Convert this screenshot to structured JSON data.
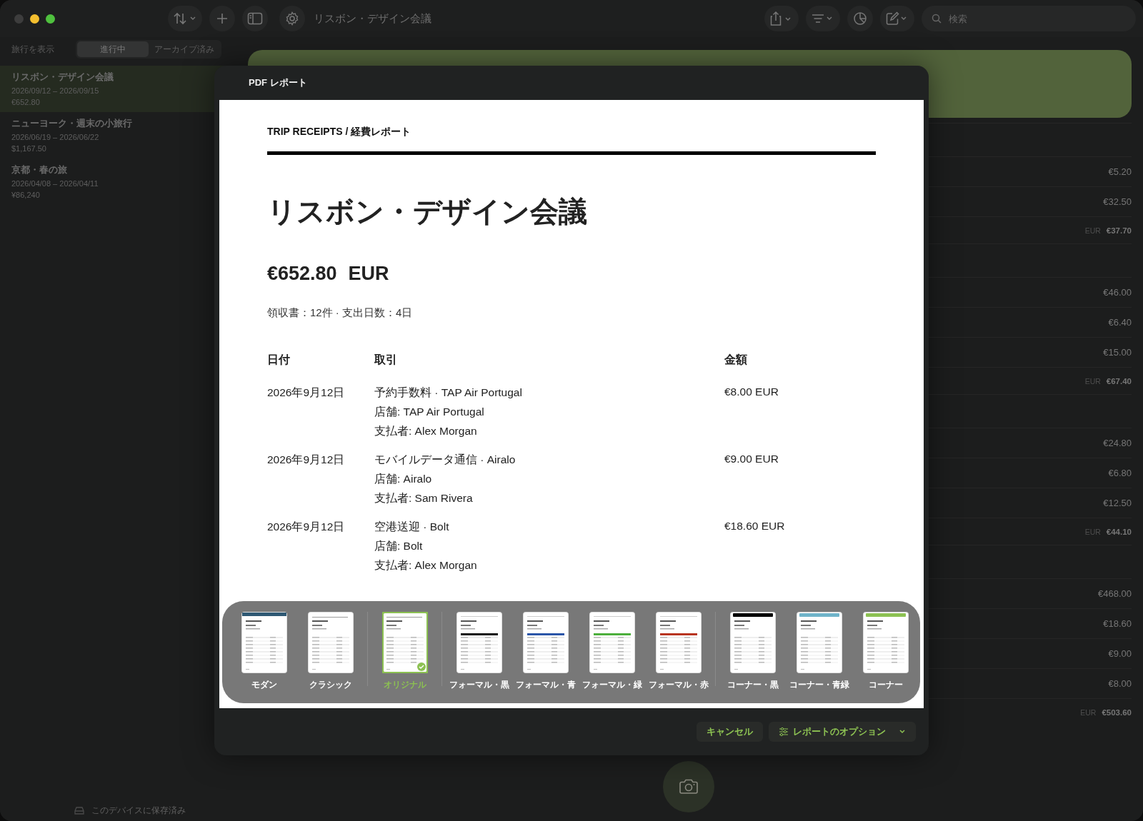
{
  "window": {
    "title": "リスボン・デザイン会議"
  },
  "toolbar": {
    "search": {
      "placeholder": "検索"
    }
  },
  "sidebar": {
    "filter_label": "旅行を表示",
    "segments": [
      {
        "label": "進行中",
        "selected": true
      },
      {
        "label": "アーカイブ済み",
        "selected": false
      }
    ],
    "trips": [
      {
        "name": "リスボン・デザイン会議",
        "dates": "2026/09/12 – 2026/09/15",
        "total": "€652.80",
        "selected": true
      },
      {
        "name": "ニューヨーク・週末の小旅行",
        "dates": "2026/06/19 – 2026/06/22",
        "total": "$1,167.50",
        "selected": false
      },
      {
        "name": "京都・春の旅",
        "dates": "2026/04/08 – 2026/04/11",
        "total": "¥86,240",
        "selected": false
      }
    ],
    "footer": "このデバイスに保存済み"
  },
  "expense_groups": [
    {
      "items": [
        "€5.20",
        "€32.50"
      ],
      "currency": "EUR",
      "total": "€37.70"
    },
    {
      "items": [
        "€46.00",
        "€6.40",
        "€15.00"
      ],
      "currency": "EUR",
      "total": "€67.40"
    },
    {
      "items": [
        "€24.80",
        "€6.80",
        "€12.50"
      ],
      "currency": "EUR",
      "total": "€44.10"
    },
    {
      "items": [
        "€468.00",
        "€18.60",
        "€9.00",
        "€8.00"
      ],
      "currency": "EUR",
      "total": "€503.60"
    }
  ],
  "dialog": {
    "title": "PDF レポート",
    "report": {
      "header": "TRIP RECEIPTS  /  経費レポート",
      "title": "リスボン・デザイン会議",
      "amount": "€652.80",
      "currency": "EUR",
      "summary": "領収書：12件 · 支出日数：4日",
      "columns": [
        "日付",
        "取引",
        "金額"
      ],
      "rows": [
        {
          "date": "2026年9月12日",
          "description": "予約手数料 · TAP Air Portugal",
          "merchant": "店舗: TAP Air Portugal",
          "payer": "支払者: Alex Morgan",
          "amount": "€8.00 EUR"
        },
        {
          "date": "2026年9月12日",
          "description": "モバイルデータ通信 · Airalo",
          "merchant": "店舗: Airalo",
          "payer": "支払者: Sam Rivera",
          "amount": "€9.00 EUR"
        },
        {
          "date": "2026年9月12日",
          "description": "空港送迎 · Bolt",
          "merchant": "店舗: Bolt",
          "payer": "支払者: Alex Morgan",
          "amount": "€18.60 EUR"
        }
      ]
    },
    "templates": [
      {
        "label": "モダン",
        "kind": "modern",
        "color": "#2e5873",
        "selected": false
      },
      {
        "label": "クラシック",
        "kind": "classic",
        "color": "#9a9a9a",
        "selected": false
      },
      {
        "label": "オリジナル",
        "kind": "original",
        "color": "#9a9a9a",
        "selected": true
      },
      {
        "label": "フォーマル・黒",
        "kind": "formal",
        "color": "#111111",
        "selected": false
      },
      {
        "label": "フォーマル・青",
        "kind": "formal",
        "color": "#2a55a8",
        "selected": false
      },
      {
        "label": "フォーマル・緑",
        "kind": "formal",
        "color": "#4caf3c",
        "selected": false
      },
      {
        "label": "フォーマル・赤",
        "kind": "formal",
        "color": "#b8341f",
        "selected": false
      },
      {
        "label": "コーナー・黒",
        "kind": "corner",
        "color": "#000000",
        "selected": false
      },
      {
        "label": "コーナー・青緑",
        "kind": "corner",
        "color": "#6fb3c9",
        "selected": false
      },
      {
        "label": "コーナー",
        "kind": "corner",
        "color": "#8cc152",
        "selected": false
      }
    ],
    "buttons": {
      "cancel": "キャンセル",
      "options": "レポートのオプション"
    }
  }
}
